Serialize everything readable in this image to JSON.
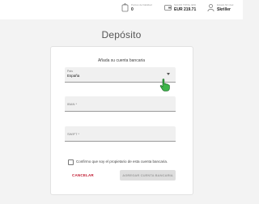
{
  "header": {
    "loyalty_label": "Puntos de fidelidad",
    "loyalty_value": "0",
    "balance_label": "SALDO TOTAL (EN)",
    "balance_value": "EUR 219.71",
    "status_label": "Estado Mi nivel",
    "status_value": "Skriller"
  },
  "page": {
    "title": "Depósito"
  },
  "form": {
    "heading": "Añada su cuenta bancaria",
    "country": {
      "label": "País",
      "value": "España"
    },
    "iban": {
      "label": "IBAN *"
    },
    "swift": {
      "label": "SWIFT *"
    },
    "confirm_text": "Confirmo que soy el propietario de esta cuenta bancaria.",
    "cancel_label": "CANCELAR",
    "submit_label": "AGREGAR CUENTA BANCARIA"
  },
  "colors": {
    "accent": "#c0182f",
    "cursor": "#3db54a"
  },
  "icons": [
    "loyalty-icon",
    "wallet-icon",
    "user-icon",
    "pointer-hand-cursor-icon",
    "dropdown-arrow-icon"
  ]
}
